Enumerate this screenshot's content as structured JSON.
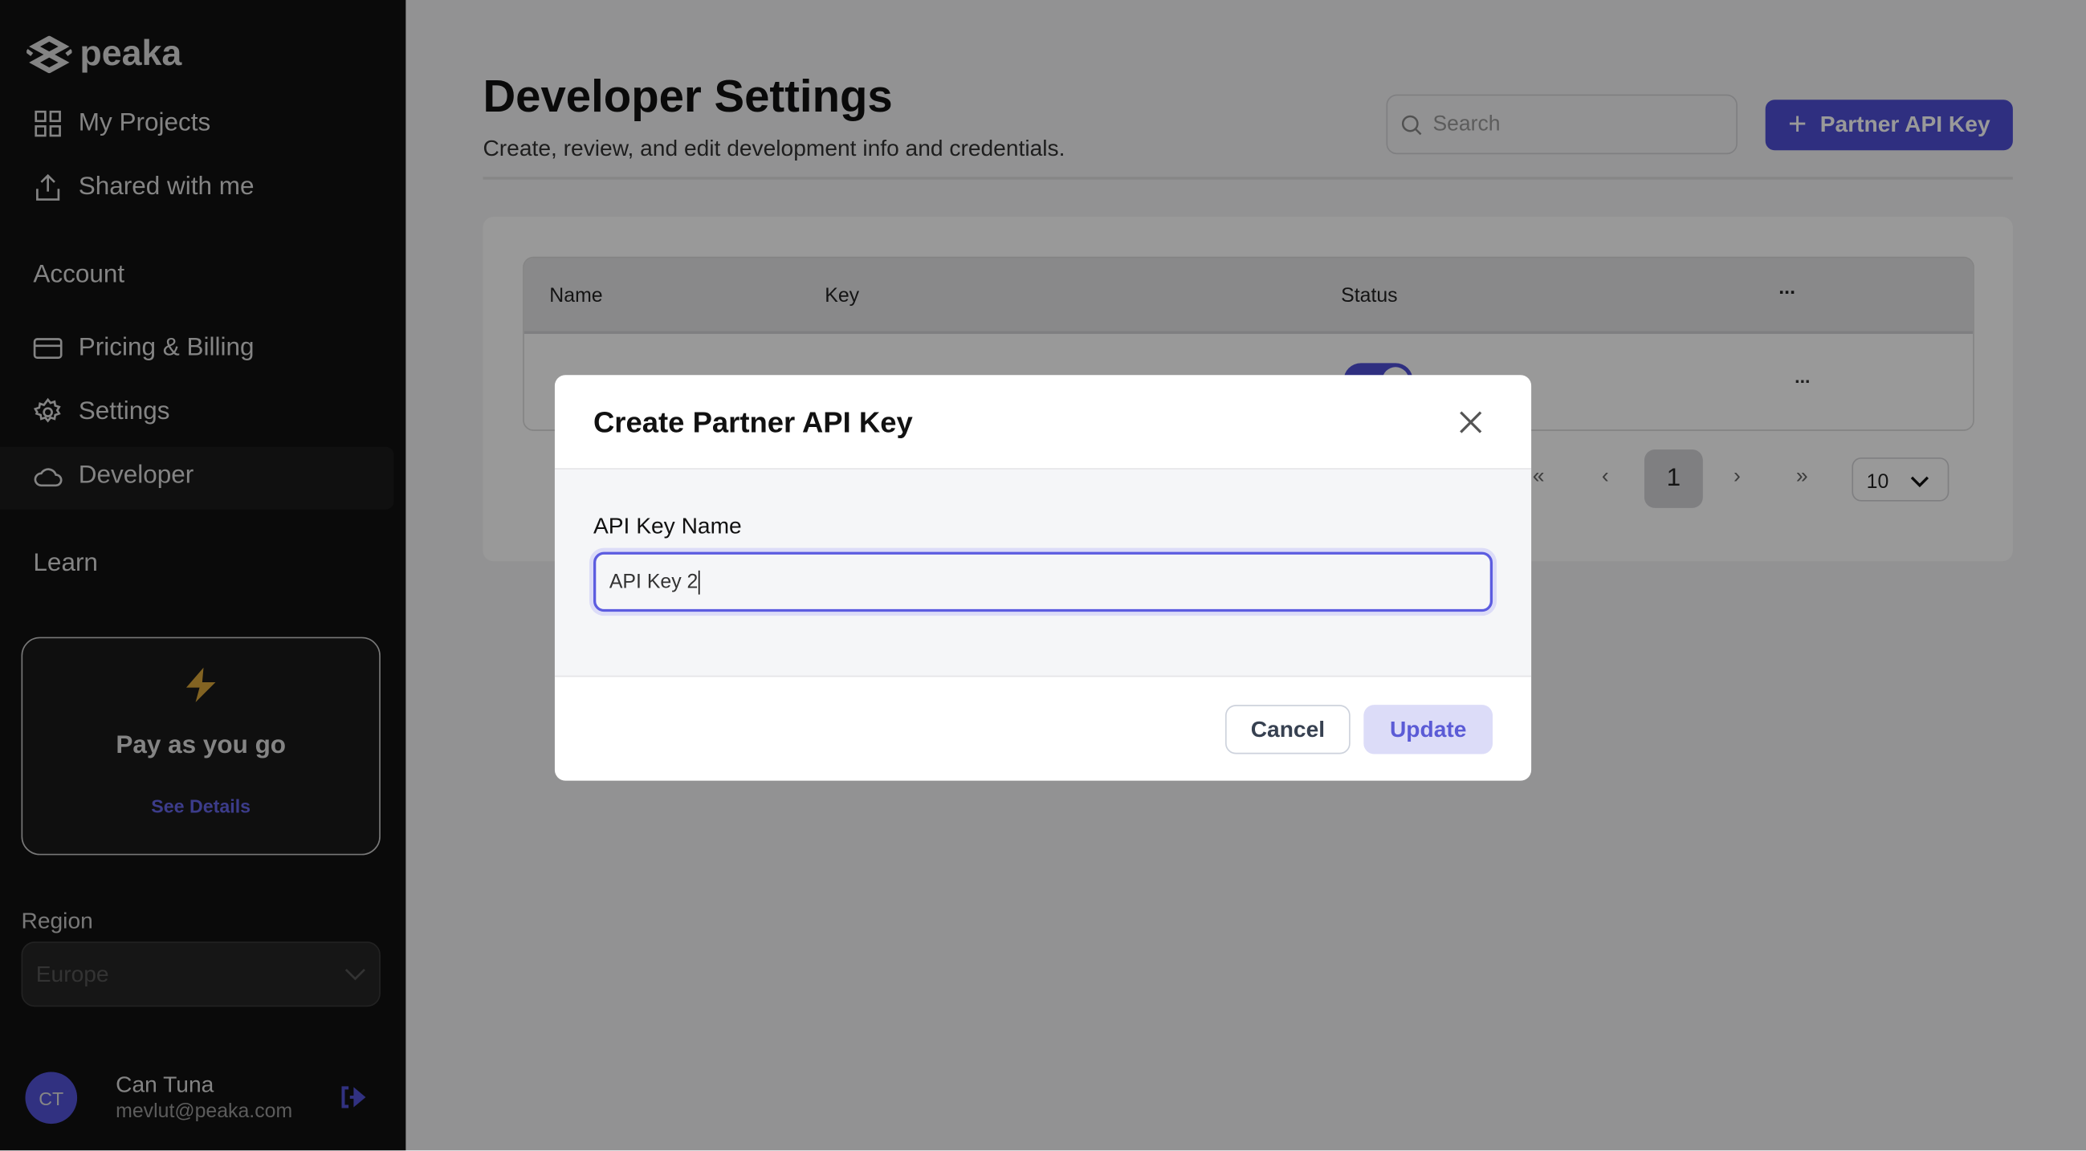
{
  "sidebar": {
    "logo": "peaka",
    "nav": [
      {
        "label": "My Projects",
        "icon": "grid-icon"
      },
      {
        "label": "Shared with me",
        "icon": "share-upload-icon"
      }
    ],
    "account_heading": "Account",
    "account_items": [
      {
        "label": "Pricing & Billing",
        "icon": "credit-card-icon"
      },
      {
        "label": "Settings",
        "icon": "gear-icon"
      },
      {
        "label": "Developer",
        "icon": "cloud-icon",
        "active": true
      }
    ],
    "learn_heading": "Learn",
    "plan_card": {
      "title": "Pay as you go",
      "link": "See Details",
      "icon": "lightning-icon"
    },
    "region": {
      "label": "Region",
      "value": "Europe"
    },
    "user": {
      "initials": "CT",
      "name": "Can Tuna",
      "email": "mevlut@peaka.com"
    }
  },
  "main": {
    "title": "Developer Settings",
    "subtitle": "Create, review, and edit development info and credentials.",
    "search_placeholder": "Search",
    "add_button": "Partner API Key",
    "table": {
      "columns": [
        "Name",
        "Key",
        "Status",
        "..."
      ],
      "rows": [
        {
          "status_enabled": true,
          "actions": "..."
        }
      ]
    },
    "pagination": {
      "first": "«",
      "prev": "‹",
      "current": "1",
      "next": "›",
      "last": "»",
      "page_size": "10"
    }
  },
  "modal": {
    "title": "Create Partner API Key",
    "field_label": "API Key Name",
    "field_value": "API Key 2",
    "cancel": "Cancel",
    "submit": "Update"
  },
  "colors": {
    "accent": "#4f4fd6",
    "sidebar_bg": "#121212",
    "gold": "#d9a53a"
  }
}
